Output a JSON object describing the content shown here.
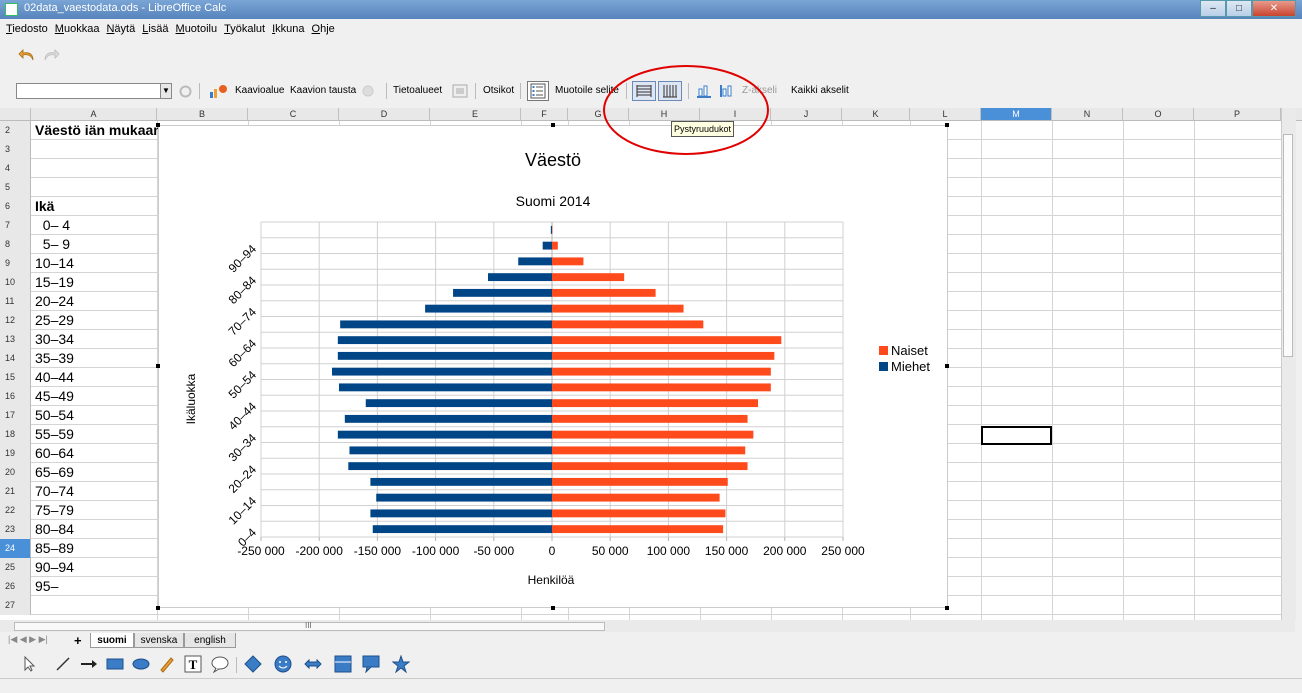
{
  "window": {
    "title": "02data_vaestodata.ods - LibreOffice Calc"
  },
  "menu": [
    "Tiedosto",
    "Muokkaa",
    "Näytä",
    "Lisää",
    "Muotoilu",
    "Työkalut",
    "Ikkuna",
    "Ohje"
  ],
  "toolbar": {
    "chart_area": "Kaavioalue",
    "chart_bg": "Kaavion tausta",
    "data_ranges": "Tietoalueet",
    "titles": "Otsikot",
    "format_legend": "Muotoile selite",
    "z_axis": "Z-akseli",
    "all_axes": "Kaikki akselit"
  },
  "tooltip": "Pystyruudukot",
  "columns": [
    "A",
    "B",
    "C",
    "D",
    "E",
    "F",
    "G",
    "H",
    "I",
    "J",
    "K",
    "L",
    "M",
    "N",
    "O",
    "P"
  ],
  "selected_column": "M",
  "rows": [
    {
      "n": "2",
      "a": "Väestö iän mukaan"
    },
    {
      "n": "3",
      "a": ""
    },
    {
      "n": "4",
      "a": ""
    },
    {
      "n": "5",
      "a": ""
    },
    {
      "n": "6",
      "a": "Ikä"
    },
    {
      "n": "7",
      "a": "  0– 4"
    },
    {
      "n": "8",
      "a": "  5– 9"
    },
    {
      "n": "9",
      "a": "10–14"
    },
    {
      "n": "10",
      "a": "15–19"
    },
    {
      "n": "11",
      "a": "20–24"
    },
    {
      "n": "12",
      "a": "25–29"
    },
    {
      "n": "13",
      "a": "30–34"
    },
    {
      "n": "14",
      "a": "35–39"
    },
    {
      "n": "15",
      "a": "40–44"
    },
    {
      "n": "16",
      "a": "45–49"
    },
    {
      "n": "17",
      "a": "50–54"
    },
    {
      "n": "18",
      "a": "55–59"
    },
    {
      "n": "19",
      "a": "60–64"
    },
    {
      "n": "20",
      "a": "65–69"
    },
    {
      "n": "21",
      "a": "70–74"
    },
    {
      "n": "22",
      "a": "75–79"
    },
    {
      "n": "23",
      "a": "80–84"
    },
    {
      "n": "24",
      "a": "85–89"
    },
    {
      "n": "25",
      "a": "90–94"
    },
    {
      "n": "26",
      "a": "95–"
    },
    {
      "n": "27",
      "a": ""
    }
  ],
  "selected_row": "24",
  "sheet_tabs": [
    "suomi",
    "svenska",
    "english"
  ],
  "active_tab": "suomi",
  "scroll_mark": "III",
  "colors": {
    "naiset": "#ff4a1c",
    "miehet": "#004586",
    "highlight_circle": "#e00000"
  },
  "chart_data": {
    "type": "bar",
    "orientation": "horizontal",
    "title": "Väestö",
    "subtitle": "Suomi 2014",
    "xlabel": "Henkilöä",
    "ylabel": "Ikäluokka",
    "xlim": [
      -250000,
      250000
    ],
    "xticks": [
      -250000,
      -200000,
      -150000,
      -100000,
      -50000,
      0,
      50000,
      100000,
      150000,
      200000,
      250000
    ],
    "xtick_labels": [
      "-250 000",
      "-200 000",
      "-150 000",
      "-100 000",
      "-50 000",
      "0",
      "50 000",
      "100 000",
      "150 000",
      "200 000",
      "250 000"
    ],
    "grid": "vertical",
    "legend": "right",
    "categories": [
      "0– 4",
      "5– 9",
      "10–14",
      "15–19",
      "20–24",
      "25–29",
      "30–34",
      "35–39",
      "40–44",
      "45–49",
      "50–54",
      "55–59",
      "60–64",
      "65–69",
      "70–74",
      "75–79",
      "80–84",
      "85–89",
      "90–94",
      "95–"
    ],
    "category_labels_shown": [
      "0– 4",
      "10–14",
      "20–24",
      "30–34",
      "40–44",
      "50–54",
      "60–64",
      "70–74",
      "80–84",
      "90–94"
    ],
    "series": [
      {
        "name": "Naiset",
        "values": [
          147000,
          149000,
          144000,
          151000,
          168000,
          166000,
          173000,
          168000,
          177000,
          188000,
          188000,
          191000,
          197000,
          130000,
          113000,
          89000,
          62000,
          27000,
          5000,
          0
        ]
      },
      {
        "name": "Miehet",
        "values": [
          -154000,
          -156000,
          -151000,
          -156000,
          -175000,
          -174000,
          -184000,
          -178000,
          -160000,
          -183000,
          -189000,
          -184000,
          -184000,
          -182000,
          -109000,
          -85000,
          -55000,
          -29000,
          -8000,
          -1000
        ]
      }
    ]
  }
}
